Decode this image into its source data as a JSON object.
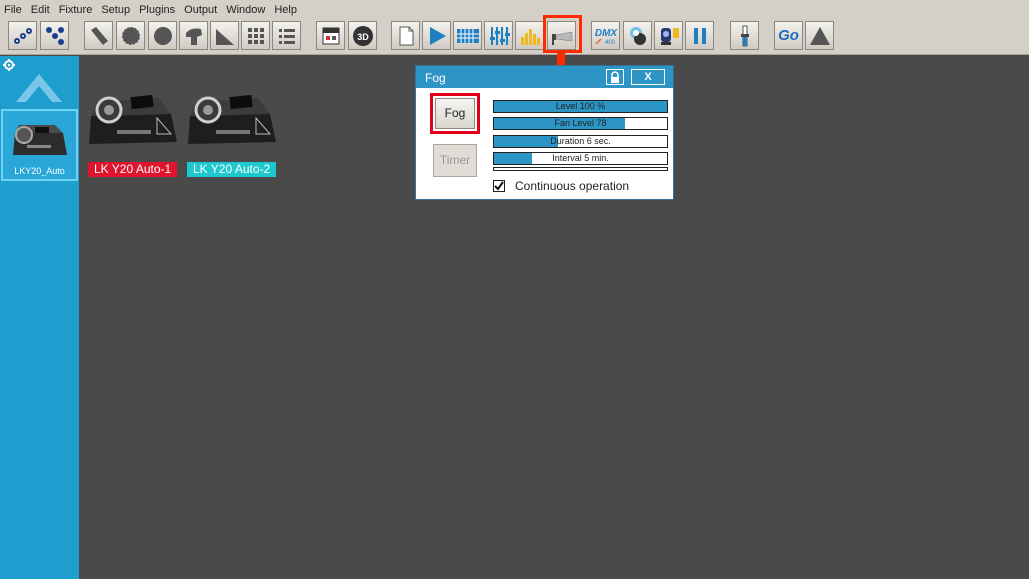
{
  "menu": [
    "File",
    "Edit",
    "Fixture",
    "Setup",
    "Plugins",
    "Output",
    "Window",
    "Help"
  ],
  "toolbar": {
    "icons": [
      "group-fixtures-icon",
      "ungroup-fixtures-icon",
      "beam-icon",
      "circle-icon",
      "circle-rotate-icon",
      "pan-tilt-icon",
      "fan-icon",
      "grid-icon",
      "list-icon",
      "stage-view-icon",
      "3d-view-icon",
      "new-page-icon",
      "play-icon",
      "matrix-icon",
      "faders-icon",
      "audio-level-icon",
      "fog-machine-icon",
      "dmx-input-icon",
      "color-wheel-icon",
      "moving-head-icon",
      "pause-icon",
      "master-fader-icon",
      "go-button",
      "blackout-icon"
    ],
    "dmx_label": "DMX",
    "dmx_sub": "400",
    "threed_label": "3D",
    "go_label": "Go"
  },
  "sidebar": {
    "group_label": "LKY20_Auto"
  },
  "fixtures": [
    {
      "label": "LK Y20 Auto-1",
      "color": "#e0142c"
    },
    {
      "label": "LK Y20 Auto-2",
      "color": "#1ec8cf"
    }
  ],
  "fog_dialog": {
    "title": "Fog",
    "close_label": "X",
    "fog_button": "Fog",
    "timer_button": "Timer",
    "bars": {
      "level": {
        "text": "Level 100 %",
        "value": 1.0
      },
      "fan": {
        "text": "Fan Level 78",
        "value": 0.76
      },
      "duration": {
        "text": "Duration 6 sec.",
        "value": 0.37
      },
      "interval": {
        "text": "Interval 5 min.",
        "value": 0.22
      }
    },
    "continuous_label": "Continuous operation",
    "continuous_checked": true
  },
  "colors": {
    "accent": "#2d94c6",
    "sidebar": "#1d9ecf",
    "highlight": "#ff2a00",
    "workspace": "#4a4a4a"
  }
}
